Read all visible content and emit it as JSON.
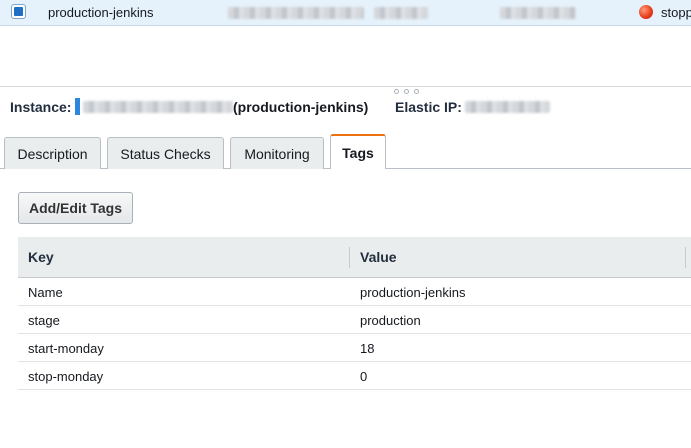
{
  "instance_row": {
    "name": "production-jenkins",
    "status": "stopp"
  },
  "detail": {
    "instance_label": "Instance:",
    "instance_name": "(production-jenkins)",
    "elastic_ip_label": "Elastic IP:"
  },
  "tabs": [
    {
      "label": "Description"
    },
    {
      "label": "Status Checks"
    },
    {
      "label": "Monitoring"
    },
    {
      "label": "Tags"
    }
  ],
  "active_tab": "Tags",
  "tags": {
    "add_button": "Add/Edit Tags",
    "columns": [
      "Key",
      "Value"
    ],
    "rows": [
      {
        "key": "Name",
        "value": "production-jenkins"
      },
      {
        "key": "stage",
        "value": "production"
      },
      {
        "key": "start-monday",
        "value": "18"
      },
      {
        "key": "stop-monday",
        "value": "0"
      }
    ]
  },
  "colors": {
    "selected_row": "#e6f2fb",
    "active_tab_accent": "#ec7211",
    "status_stopped": "#e5391b",
    "checkbox_accent": "#1f6fc6"
  }
}
